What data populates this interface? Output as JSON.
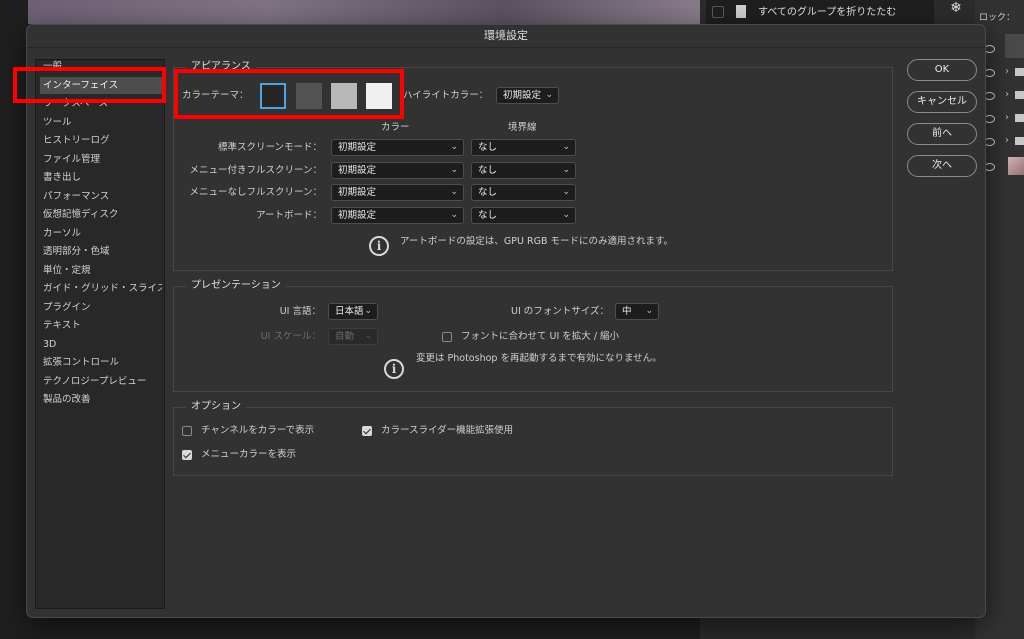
{
  "background": {
    "menu_item_label": "すべてのグループを折りたたむ",
    "lock_label": "ロック："
  },
  "dialog": {
    "title": "環境設定"
  },
  "sidebar": {
    "items": [
      {
        "label": "一般",
        "active": false
      },
      {
        "label": "インターフェイス",
        "active": true
      },
      {
        "label": "ワークスペース",
        "active": false
      },
      {
        "label": "ツール",
        "active": false
      },
      {
        "label": "ヒストリーログ",
        "active": false
      },
      {
        "label": "ファイル管理",
        "active": false
      },
      {
        "label": "書き出し",
        "active": false
      },
      {
        "label": "パフォーマンス",
        "active": false
      },
      {
        "label": "仮想記憶ディスク",
        "active": false
      },
      {
        "label": "カーソル",
        "active": false
      },
      {
        "label": "透明部分・色域",
        "active": false
      },
      {
        "label": "単位・定規",
        "active": false
      },
      {
        "label": "ガイド・グリッド・スライス",
        "active": false
      },
      {
        "label": "プラグイン",
        "active": false
      },
      {
        "label": "テキスト",
        "active": false
      },
      {
        "label": "3D",
        "active": false
      },
      {
        "label": "拡張コントロール",
        "active": false
      },
      {
        "label": "テクノロジープレビュー",
        "active": false
      },
      {
        "label": "製品の改善",
        "active": false
      }
    ]
  },
  "appearance": {
    "section_label": "アピアランス",
    "color_theme_label": "カラーテーマ：",
    "themes": [
      {
        "name": "darkest",
        "color": "#262626",
        "selected": true
      },
      {
        "name": "dark",
        "color": "#535353",
        "selected": false
      },
      {
        "name": "medium",
        "color": "#b8b8b8",
        "selected": false
      },
      {
        "name": "light",
        "color": "#f0f0f0",
        "selected": false
      }
    ],
    "highlight_label": "ハイライトカラー：",
    "highlight_value": "初期設定",
    "col_color": "カラー",
    "col_border": "境界線",
    "rows": [
      {
        "label": "標準スクリーンモード：",
        "color": "初期設定",
        "border": "なし"
      },
      {
        "label": "メニュー付きフルスクリーン：",
        "color": "初期設定",
        "border": "なし"
      },
      {
        "label": "メニューなしフルスクリーン：",
        "color": "初期設定",
        "border": "なし"
      },
      {
        "label": "アートボード：",
        "color": "初期設定",
        "border": "なし"
      }
    ],
    "info_text": "アートボードの設定は、GPU RGB モードにのみ適用されます。"
  },
  "presentation": {
    "section_label": "プレゼンテーション",
    "ui_language_label": "UI 言語：",
    "ui_language_value": "日本語",
    "ui_font_size_label": "UI のフォントサイズ：",
    "ui_font_size_value": "中",
    "ui_scale_label": "UI スケール：",
    "ui_scale_value": "自動",
    "scale_with_font_label": "フォントに合わせて UI を拡大 / 縮小",
    "scale_with_font_checked": false,
    "info_text": "変更は Photoshop を再起動するまで有効になりません。"
  },
  "options": {
    "section_label": "オプション",
    "channels_in_color_label": "チャンネルをカラーで表示",
    "channels_in_color_checked": false,
    "color_slider_label": "カラースライダー機能拡張使用",
    "color_slider_checked": true,
    "menu_color_label": "メニューカラーを表示",
    "menu_color_checked": true
  },
  "buttons": {
    "ok": "OK",
    "cancel": "キャンセル",
    "prev": "前へ",
    "next": "次へ"
  },
  "annotation_color": "#ff0000"
}
